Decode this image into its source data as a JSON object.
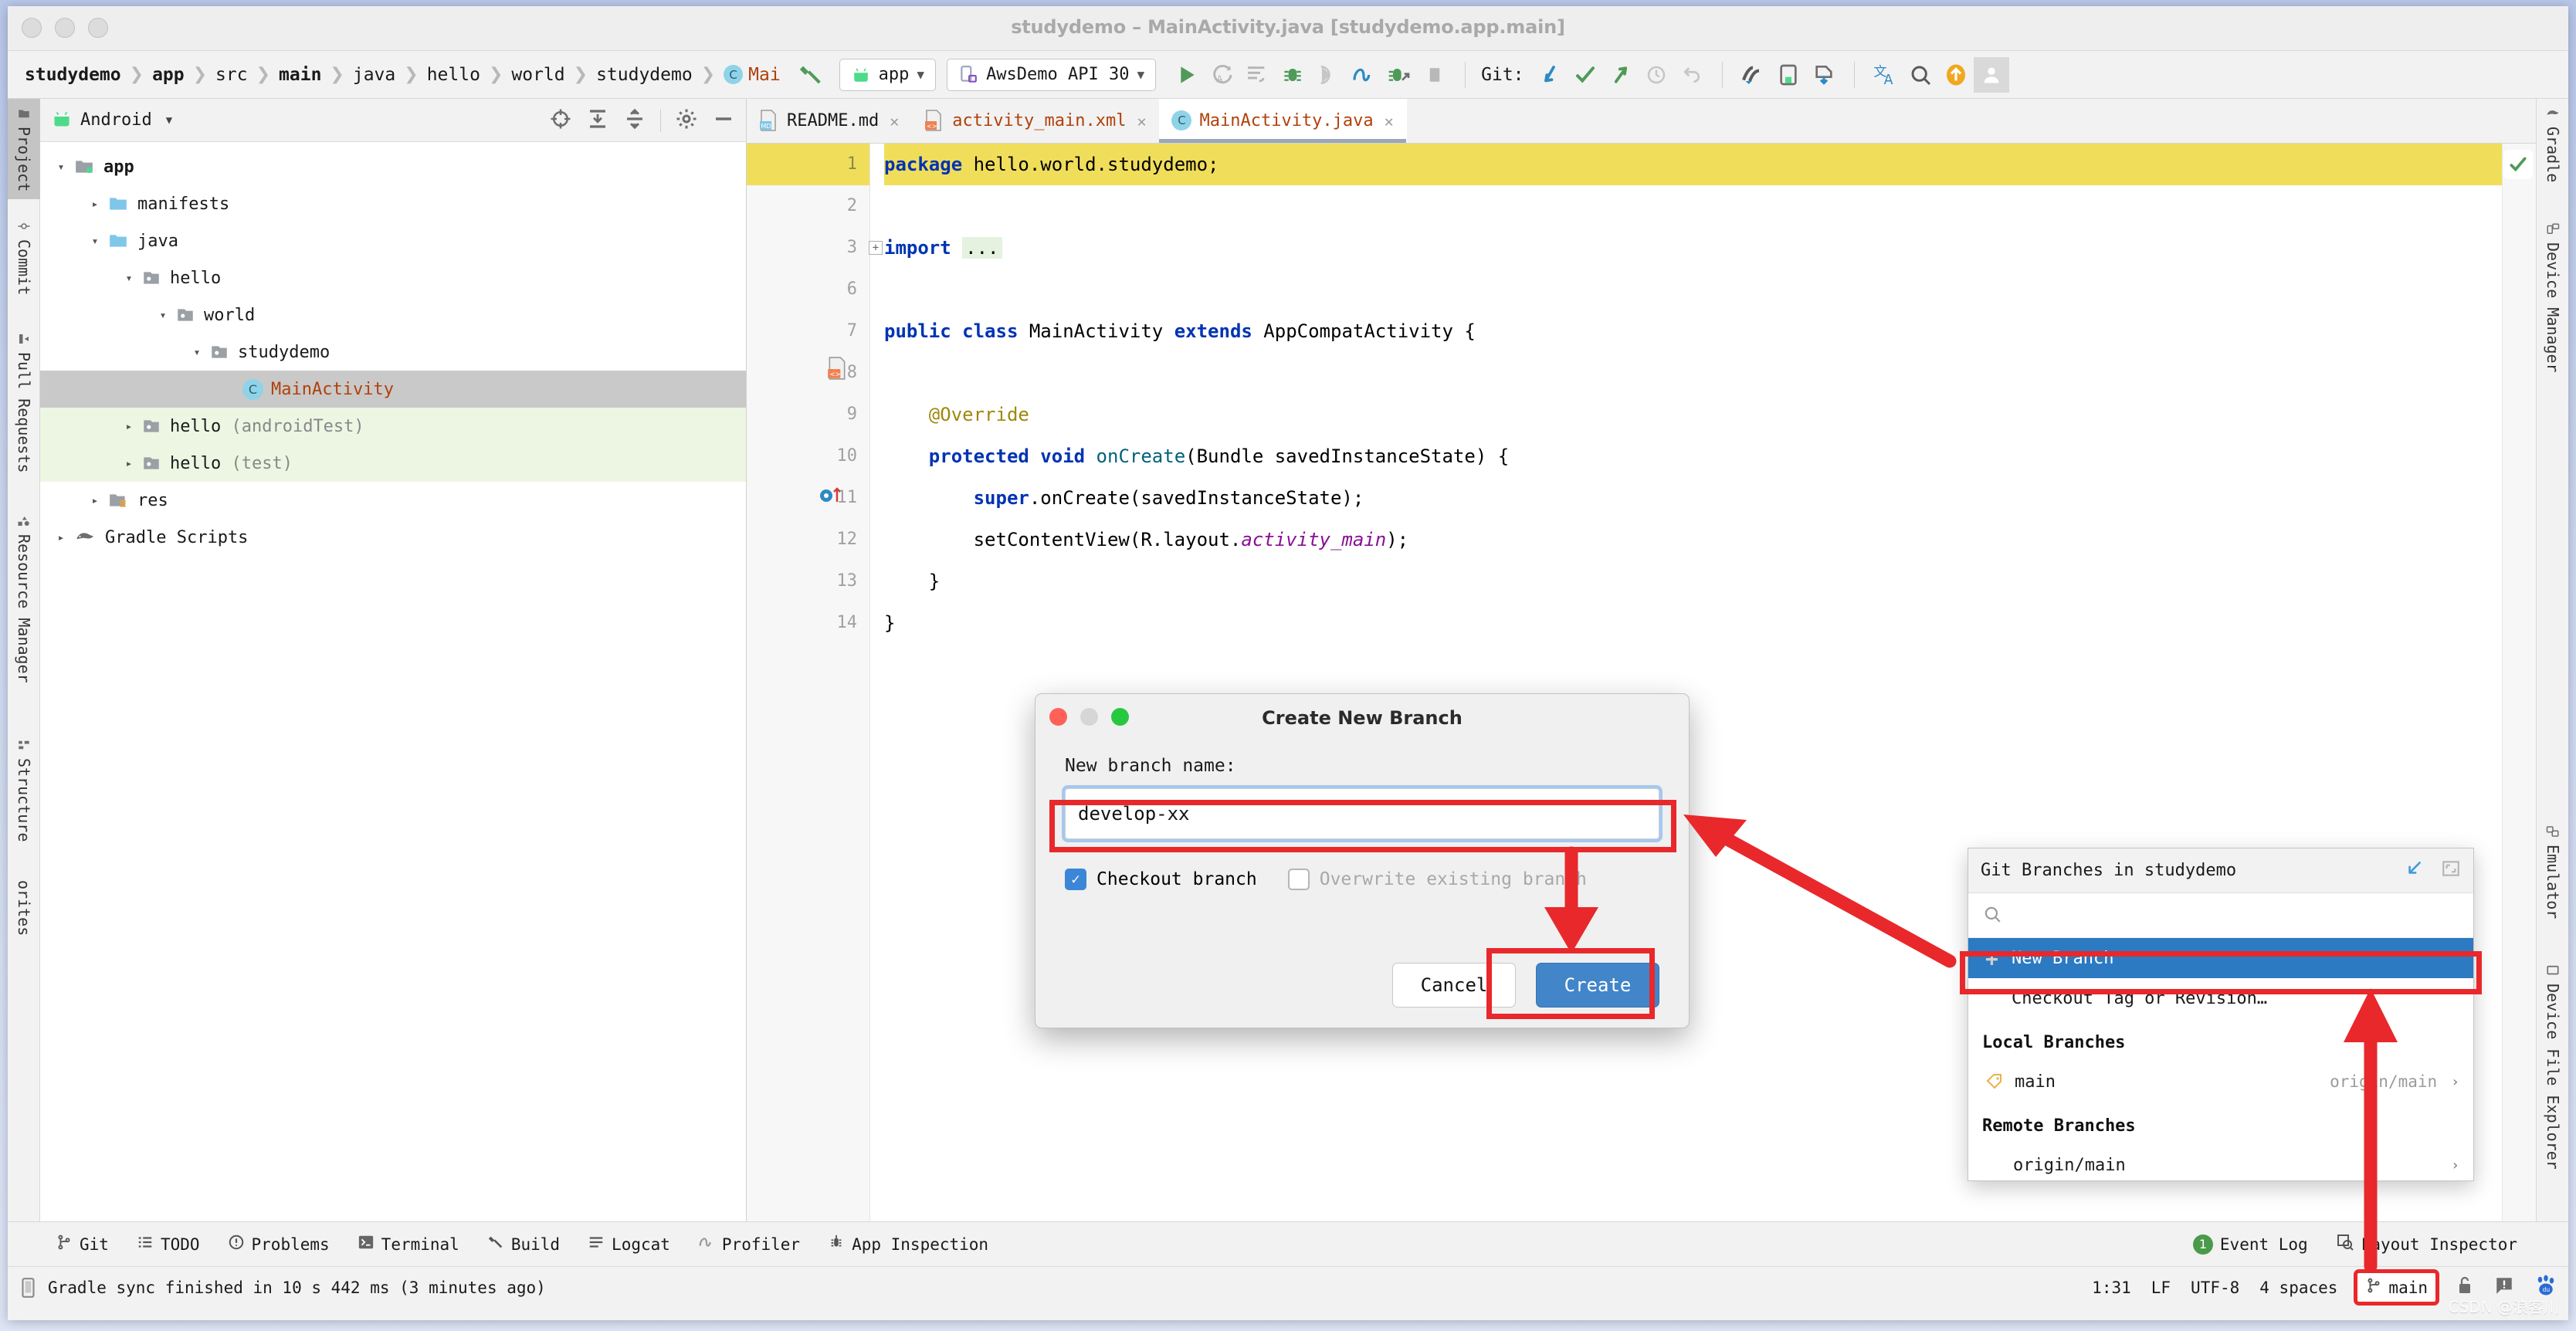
{
  "window": {
    "title": "studydemo – MainActivity.java [studydemo.app.main]"
  },
  "breadcrumbs": [
    {
      "label": "studydemo",
      "bold": true
    },
    {
      "label": "app",
      "bold": true
    },
    {
      "label": "src",
      "bold": false
    },
    {
      "label": "main",
      "bold": true
    },
    {
      "label": "java",
      "bold": false
    },
    {
      "label": "hello",
      "bold": false
    },
    {
      "label": "world",
      "bold": false
    },
    {
      "label": "studydemo",
      "bold": false
    }
  ],
  "breadcrumb_class": {
    "badge": "C",
    "name": "Mai"
  },
  "toolbar": {
    "module_selector": "app",
    "device_selector": "AwsDemo API 30",
    "git_label": "Git:",
    "icons": [
      "run-icon",
      "rerun-icon",
      "apply-changes-icon",
      "debug-icon",
      "attach-debugger-icon",
      "profiler-icon",
      "debug-apply-icon",
      "stop-icon"
    ],
    "git_icons": [
      "update-project-icon",
      "commit-icon",
      "push-icon",
      "history-icon",
      "revert-icon"
    ],
    "right_icons": [
      "avd-manager-icon",
      "sdk-manager-icon",
      "device-file-icon",
      "translate-icon",
      "search-icon",
      "update-icon",
      "account-icon"
    ]
  },
  "project_panel": {
    "title": "Android",
    "actions": [
      "locate-icon",
      "expand-all-icon",
      "collapse-all-icon",
      "settings-icon",
      "hide-icon"
    ],
    "tree": [
      {
        "label": "app",
        "indent": 0,
        "arrow": "open",
        "icon": "module-folder-icon",
        "bold": true,
        "state": "normal"
      },
      {
        "label": "manifests",
        "indent": 1,
        "arrow": "closed",
        "icon": "folder-blue-icon",
        "bold": false,
        "state": "normal"
      },
      {
        "label": "java",
        "indent": 1,
        "arrow": "open",
        "icon": "folder-blue-icon",
        "bold": false,
        "state": "normal"
      },
      {
        "label": "hello",
        "indent": 2,
        "arrow": "open",
        "icon": "package-icon",
        "bold": false,
        "state": "normal"
      },
      {
        "label": "world",
        "indent": 3,
        "arrow": "open",
        "icon": "package-icon",
        "bold": false,
        "state": "normal"
      },
      {
        "label": "studydemo",
        "indent": 4,
        "arrow": "open",
        "icon": "package-icon",
        "bold": false,
        "state": "normal"
      },
      {
        "label": "MainActivity",
        "indent": 5,
        "arrow": "none",
        "icon": "class-icon",
        "bold": false,
        "state": "selected"
      },
      {
        "label": "hello",
        "suffix": " (androidTest)",
        "indent": 2,
        "arrow": "closed",
        "icon": "package-icon",
        "bold": false,
        "state": "test"
      },
      {
        "label": "hello",
        "suffix": " (test)",
        "indent": 2,
        "arrow": "closed",
        "icon": "package-icon",
        "bold": false,
        "state": "test"
      },
      {
        "label": "res",
        "indent": 1,
        "arrow": "closed",
        "icon": "res-folder-icon",
        "bold": false,
        "state": "normal"
      },
      {
        "label": "Gradle Scripts",
        "indent": 0,
        "arrow": "closed",
        "icon": "gradle-icon",
        "bold": false,
        "state": "normal"
      }
    ]
  },
  "editor": {
    "tabs": [
      {
        "label": "README.md",
        "icon": "markdown-file-icon",
        "active": false,
        "color": "dark"
      },
      {
        "label": "activity_main.xml",
        "icon": "xml-file-icon",
        "active": false,
        "color": "red"
      },
      {
        "label": "MainActivity.java",
        "icon": "java-class-icon",
        "active": true,
        "color": "red"
      }
    ],
    "line_numbers": [
      "1",
      "2",
      "3",
      "6",
      "7",
      "8",
      "9",
      "10",
      "11",
      "12",
      "13",
      "14"
    ],
    "code_lines": [
      {
        "n": "1",
        "highlight": true,
        "html": "<span class=\"kw\">package</span> hello.world.studydemo;"
      },
      {
        "n": "2",
        "highlight": false,
        "html": ""
      },
      {
        "n": "3",
        "highlight": false,
        "html": "<span class=\"kw\">import</span> <span class=\"import-hl\">...</span>"
      },
      {
        "n": "6",
        "highlight": false,
        "html": ""
      },
      {
        "n": "7",
        "highlight": false,
        "html": "<span class=\"kw\">public</span> <span class=\"kw\">class</span> MainActivity <span class=\"kw\">extends</span> AppCompatActivity {"
      },
      {
        "n": "8",
        "highlight": false,
        "html": ""
      },
      {
        "n": "9",
        "highlight": false,
        "html": "    <span class=\"ann\">@Override</span>"
      },
      {
        "n": "10",
        "highlight": false,
        "html": "    <span class=\"kw\">protected</span> <span class=\"kw\">void</span> <span class=\"fn\">onCreate</span>(Bundle savedInstanceState) {"
      },
      {
        "n": "11",
        "highlight": false,
        "html": "        <span class=\"kw\">super</span>.onCreate(savedInstanceState);"
      },
      {
        "n": "12",
        "highlight": false,
        "html": "        setContentView(R.layout.<span class=\"it\">activity_main</span>);"
      },
      {
        "n": "13",
        "highlight": false,
        "html": "    }"
      },
      {
        "n": "14",
        "highlight": false,
        "html": "}"
      }
    ],
    "inspection_status": "ok-check-icon"
  },
  "left_rail": [
    {
      "label": "Project",
      "icon": "project-icon",
      "selected": true
    },
    {
      "label": "Commit",
      "icon": "commit-icon",
      "selected": false
    },
    {
      "label": "Pull Requests",
      "icon": "pull-requests-icon",
      "selected": false
    },
    {
      "label": "Resource Manager",
      "icon": "resource-manager-icon",
      "selected": false
    },
    {
      "label": "Structure",
      "icon": "structure-icon",
      "selected": false
    },
    {
      "label": "orites",
      "icon": "favorites-icon",
      "selected": false
    }
  ],
  "right_rail": [
    {
      "label": "Gradle",
      "icon": "gradle-icon",
      "selected": false
    },
    {
      "label": "Device Manager",
      "icon": "device-manager-icon",
      "selected": false
    },
    {
      "label": "Emulator",
      "icon": "emulator-icon",
      "selected": false
    },
    {
      "label": "Device File Explorer",
      "icon": "device-file-explorer-icon",
      "selected": false
    }
  ],
  "tool_window_bar": {
    "left_items": [
      {
        "label": "Git",
        "icon": "git-branch-icon"
      },
      {
        "label": "TODO",
        "icon": "todo-icon"
      },
      {
        "label": "Problems",
        "icon": "problems-icon"
      },
      {
        "label": "Terminal",
        "icon": "terminal-icon"
      },
      {
        "label": "Build",
        "icon": "build-hammer-icon"
      },
      {
        "label": "Logcat",
        "icon": "logcat-icon"
      },
      {
        "label": "Profiler",
        "icon": "profiler-icon"
      },
      {
        "label": "App Inspection",
        "icon": "app-inspection-icon"
      }
    ],
    "right_items": [
      {
        "label": "Event Log",
        "icon": "event-log-icon",
        "badge": "1"
      },
      {
        "label": "Layout Inspector",
        "icon": "layout-inspector-icon"
      }
    ]
  },
  "status_bar": {
    "message": "Gradle sync finished in 10 s 442 ms (3 minutes ago)",
    "message_icon": "notification-icon",
    "caret_position": "1:31",
    "line_separator": "LF",
    "encoding": "UTF-8",
    "indent": "4 spaces",
    "branch": "main",
    "branch_icon": "git-branch-icon",
    "trailing_icons": [
      "lock-icon",
      "feedback-icon",
      "baidu-icon"
    ]
  },
  "dialog": {
    "title": "Create New Branch",
    "label": "New branch name:",
    "input_value": "develop-xx",
    "checkbox_checked": {
      "label": "Checkout branch",
      "checked": true
    },
    "checkbox_disabled": {
      "label": "Overwrite existing branch",
      "checked": false
    },
    "cancel_label": "Cancel",
    "create_label": "Create"
  },
  "git_popup": {
    "title": "Git Branches in studydemo",
    "header_icons": [
      "open-in-window-icon",
      "expand-icon"
    ],
    "search_placeholder": "",
    "search_icon": "search-icon",
    "actions": [
      {
        "label": "New Branch",
        "icon": "plus-icon",
        "selected": true
      },
      {
        "label": "Checkout Tag or Revision…",
        "icon": "",
        "selected": false
      }
    ],
    "sections": [
      {
        "title": "Local Branches",
        "branches": [
          {
            "name": "main",
            "icon": "tag-icon",
            "tracking": "origin/main",
            "chevron": "›"
          }
        ]
      },
      {
        "title": "Remote Branches",
        "branches": [
          {
            "name": "origin/main",
            "icon": "",
            "tracking": "",
            "chevron": "›"
          }
        ]
      }
    ]
  },
  "annotations": {
    "accent_color": "#e8282b",
    "watermark": "CSDN @浪客川"
  }
}
